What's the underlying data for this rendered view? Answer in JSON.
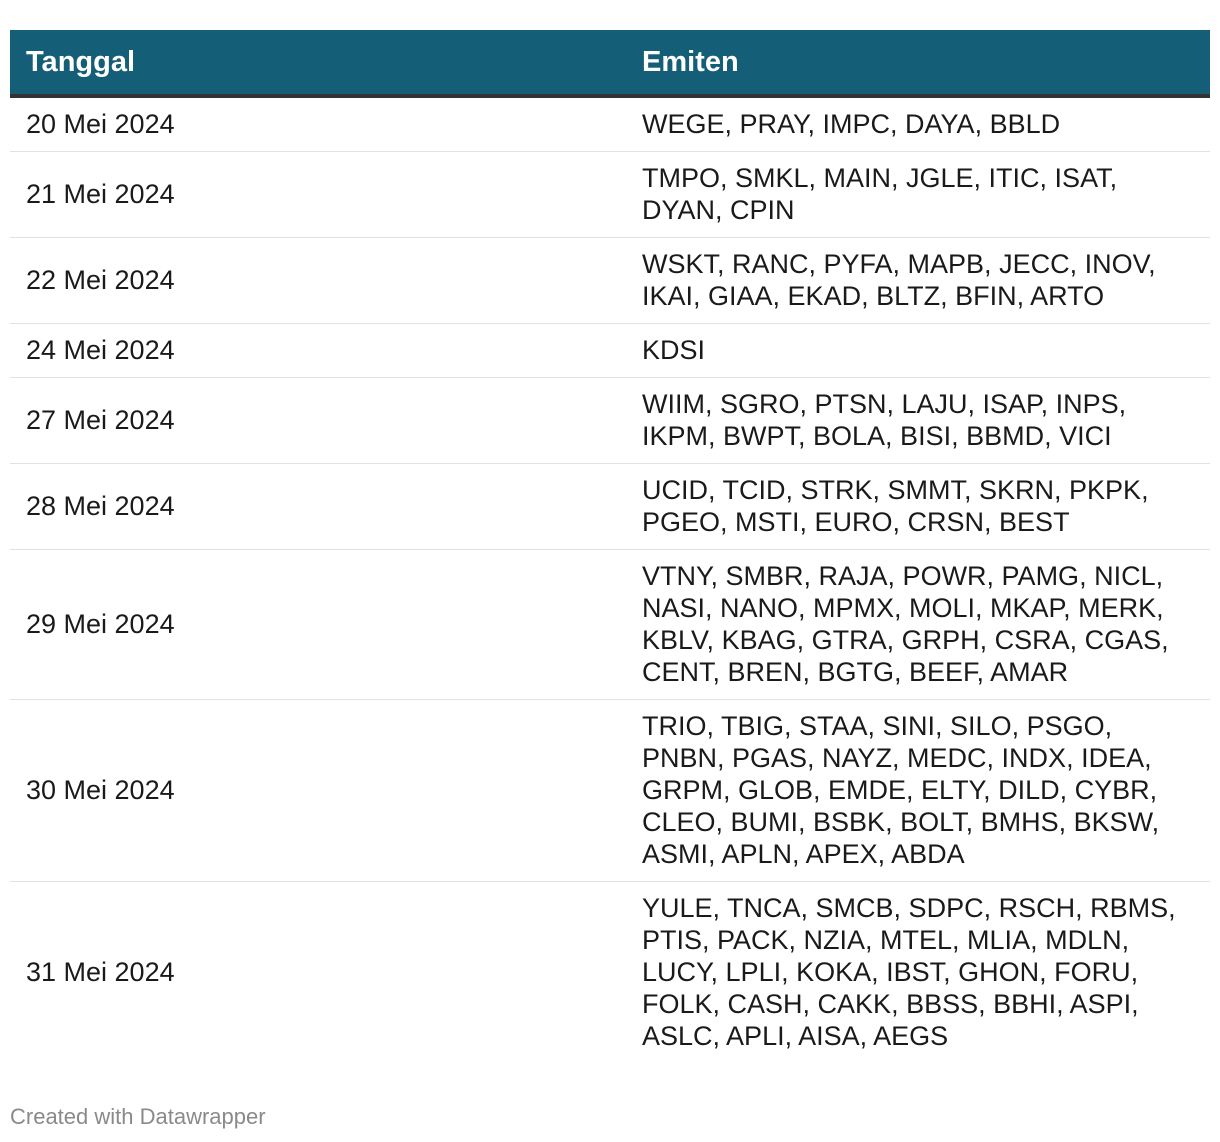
{
  "chart_data": {
    "type": "table",
    "columns": [
      "Tanggal",
      "Emiten"
    ],
    "rows": [
      [
        "20 Mei 2024",
        "WEGE, PRAY, IMPC, DAYA, BBLD"
      ],
      [
        "21 Mei 2024",
        "TMPO, SMKL, MAIN, JGLE, ITIC, ISAT, DYAN, CPIN"
      ],
      [
        "22 Mei 2024",
        "WSKT, RANC, PYFA, MAPB, JECC, INOV, IKAI, GIAA, EKAD, BLTZ, BFIN, ARTO"
      ],
      [
        "24 Mei 2024",
        "KDSI"
      ],
      [
        "27 Mei 2024",
        "WIIM, SGRO, PTSN, LAJU, ISAP, INPS, IKPM, BWPT, BOLA, BISI, BBMD, VICI"
      ],
      [
        "28 Mei 2024",
        "UCID, TCID, STRK, SMMT, SKRN, PKPK, PGEO, MSTI, EURO, CRSN, BEST"
      ],
      [
        "29 Mei 2024",
        "VTNY, SMBR, RAJA, POWR, PAMG, NICL, NASI, NANO, MPMX, MOLI, MKAP, MERK, KBLV, KBAG, GTRA, GRPH, CSRA, CGAS, CENT, BREN, BGTG, BEEF, AMAR"
      ],
      [
        "30 Mei 2024",
        "TRIO, TBIG, STAA, SINI, SILO, PSGO, PNBN, PGAS, NAYZ, MEDC, INDX, IDEA, GRPM, GLOB, EMDE, ELTY, DILD, CYBR, CLEO, BUMI, BSBK, BOLT, BMHS, BKSW, ASMI, APLN, APEX, ABDA"
      ],
      [
        "31 Mei 2024",
        "YULE, TNCA, SMCB, SDPC, RSCH, RBMS, PTIS, PACK, NZIA, MTEL, MLIA, MDLN, LUCY, LPLI, KOKA, IBST, GHON, FORU, FOLK, CASH, CAKK, BBSS, BBHI, ASPI, ASLC, APLI, AISA, AEGS"
      ]
    ],
    "header_color": "#155e78"
  },
  "footer": {
    "credit": "Created with Datawrapper"
  }
}
